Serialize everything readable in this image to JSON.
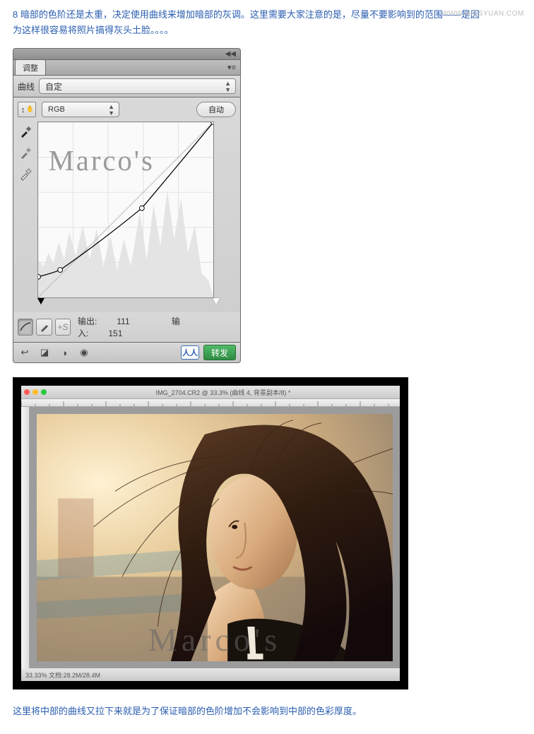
{
  "watermark_site": "WWW.MISSYUAN.COM",
  "step": {
    "num": "8",
    "line1": "暗部的色阶还是太重，决定使用曲线来增加暗部的灰调。这里需要大家注意的是，尽量不要影响到的范围——是因",
    "line2": "为这样很容易将照片搞得灰头土脸。。。。"
  },
  "panel": {
    "tab": "调整",
    "preset_label": "曲线",
    "preset_value": "自定",
    "channel": "RGB",
    "auto": "自动",
    "output_label": "输出:",
    "output_value": "111",
    "input_label": "输入:",
    "input_value": "151",
    "share": "转发",
    "graph_watermark": "Marco's"
  },
  "chart_data": {
    "type": "line",
    "title": "Curves",
    "xlabel": "Input",
    "ylabel": "Output",
    "xlim": [
      0,
      255
    ],
    "ylim": [
      0,
      255
    ],
    "series": [
      {
        "name": "curve",
        "x": [
          0,
          32,
          151,
          255
        ],
        "y": [
          30,
          40,
          130,
          255
        ]
      }
    ],
    "readout": {
      "input": 151,
      "output": 111
    }
  },
  "photoshop": {
    "doc_title": "IMG_2704.CR2 @ 33.3% (曲线 4, 背景副本/8) *",
    "status": "33.33%   文档:28.2M/28.4M",
    "watermark": "Marco's"
  },
  "caption": "这里将中部的曲线又拉下来就是为了保证暗部的色阶增加不会影响到中部的色彩厚度。",
  "colors": {
    "blue": "#2a5db0",
    "green_btn": "#3a9d4f"
  }
}
